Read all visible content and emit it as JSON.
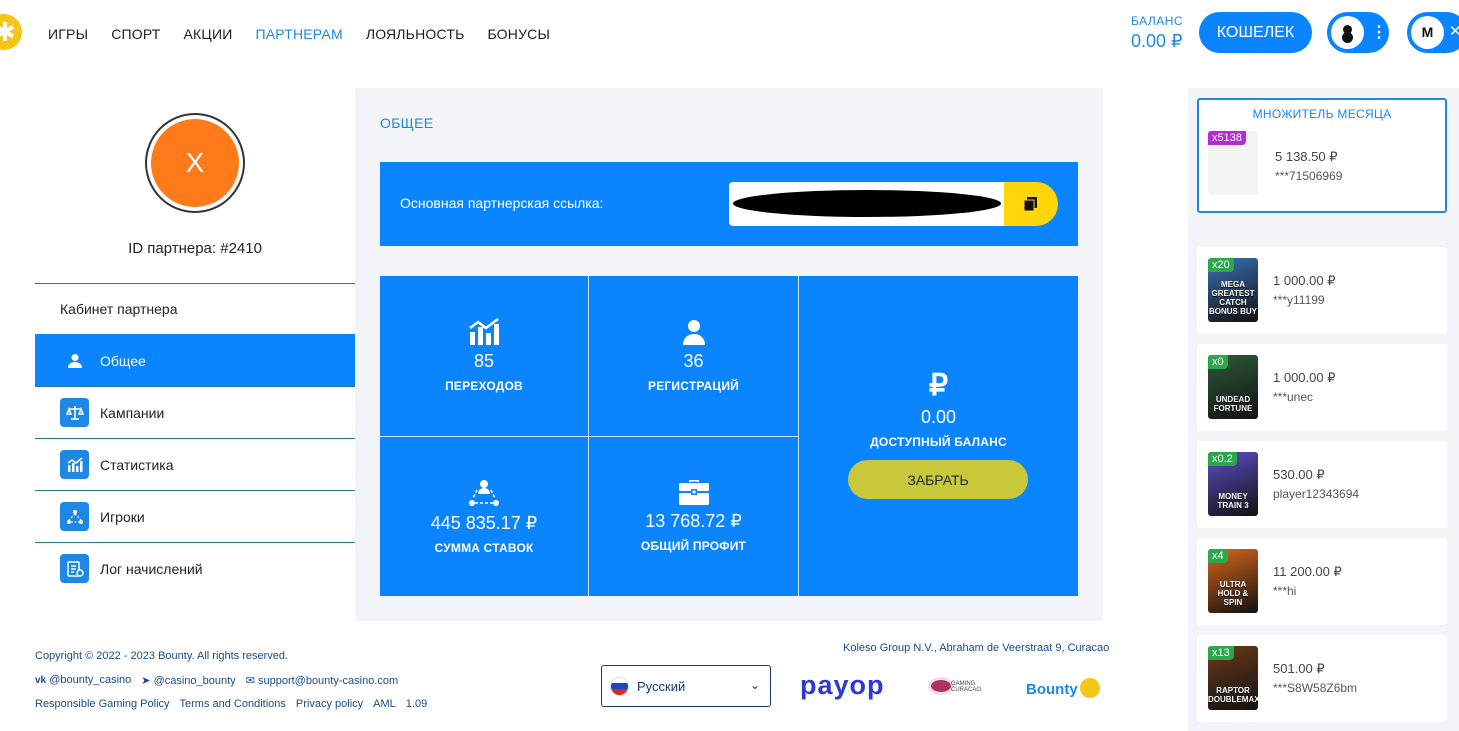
{
  "header": {
    "nav": [
      "ИГРЫ",
      "СПОРТ",
      "АКЦИИ",
      "ПАРТНЕРАМ",
      "ЛОЯЛЬНОСТЬ",
      "БОНУСЫ"
    ],
    "balance_label": "БАЛАНС",
    "balance_value": "0.00 ₽",
    "wallet_label": "КОШЕЛЕК"
  },
  "sidebar": {
    "avatar_letter": "X",
    "partner_id": "ID партнера: #2410",
    "title": "Кабинет партнера",
    "items": [
      {
        "label": "Общее",
        "icon": "user-icon"
      },
      {
        "label": "Кампании",
        "icon": "scales-icon"
      },
      {
        "label": "Статистика",
        "icon": "chart-icon"
      },
      {
        "label": "Игроки",
        "icon": "network-icon"
      },
      {
        "label": "Лог начислений",
        "icon": "log-icon"
      }
    ]
  },
  "main": {
    "section_title": "ОБЩЕЕ",
    "link_label": "Основная партнерская ссылка:",
    "stats": {
      "clicks": {
        "value": "85",
        "label": "ПЕРЕХОДОВ"
      },
      "registrations": {
        "value": "36",
        "label": "РЕГИСТРАЦИЙ"
      },
      "bets": {
        "value": "445 835.17 ₽",
        "label": "СУММА СТАВОК"
      },
      "profit": {
        "value": "13 768.72 ₽",
        "label": "ОБЩИЙ ПРОФИТ"
      },
      "balance": {
        "symbol": "₽",
        "value": "0.00",
        "label": "ДОСТУПНЫЙ БАЛАНС"
      }
    },
    "withdraw_label": "ЗАБРАТЬ"
  },
  "footer": {
    "copyright": "Copyright © 2022 - 2023 Bounty. All rights reserved.",
    "vk": "@bounty_casino",
    "telegram": "@casino_bounty",
    "email": "support@bounty-casino.com",
    "links": [
      "Responsible Gaming Policy",
      "Terms and Conditions",
      "Privacy policy",
      "AML",
      "1.09"
    ],
    "company": "Koleso Group N.V., Abraham de Veerstraat 9, Curacao",
    "language": "Русский",
    "payop": "payop",
    "gaming": "GAMING CURACAO",
    "bounty": "Bounty"
  },
  "right": {
    "month_title": "МНОЖИТЕЛЬ МЕСЯЦА",
    "month_win": {
      "mult": "x5138",
      "amount": "5 138.50 ₽",
      "user": "***71506969"
    },
    "wins": [
      {
        "mult": "x20",
        "amount": "1 000.00 ₽",
        "user": "***y11199",
        "game": "MEGA GREATEST CATCH BONUS BUY",
        "color": "#3a6fb0"
      },
      {
        "mult": "x0",
        "amount": "1 000.00 ₽",
        "user": "***unec",
        "game": "UNDEAD FORTUNE",
        "color": "#2e5a3a"
      },
      {
        "mult": "x0.2",
        "amount": "530.00 ₽",
        "user": "player12343694",
        "game": "MONEY TRAIN 3",
        "color": "#5b4fc7"
      },
      {
        "mult": "x4",
        "amount": "11 200.00 ₽",
        "user": "***hi",
        "game": "ULTRA HOLD & SPIN",
        "color": "#d8661a"
      },
      {
        "mult": "x13",
        "amount": "501.00 ₽",
        "user": "***S8W58Z6bm",
        "game": "RAPTOR DOUBLEMAX",
        "color": "#6b3a1a"
      }
    ]
  },
  "colors": {
    "accent": "#0a84ff",
    "withdraw": "#c8c83a",
    "copy": "#ffd60a",
    "mult_green": "#2aa84a",
    "mult_purple": "#b52ad6"
  }
}
